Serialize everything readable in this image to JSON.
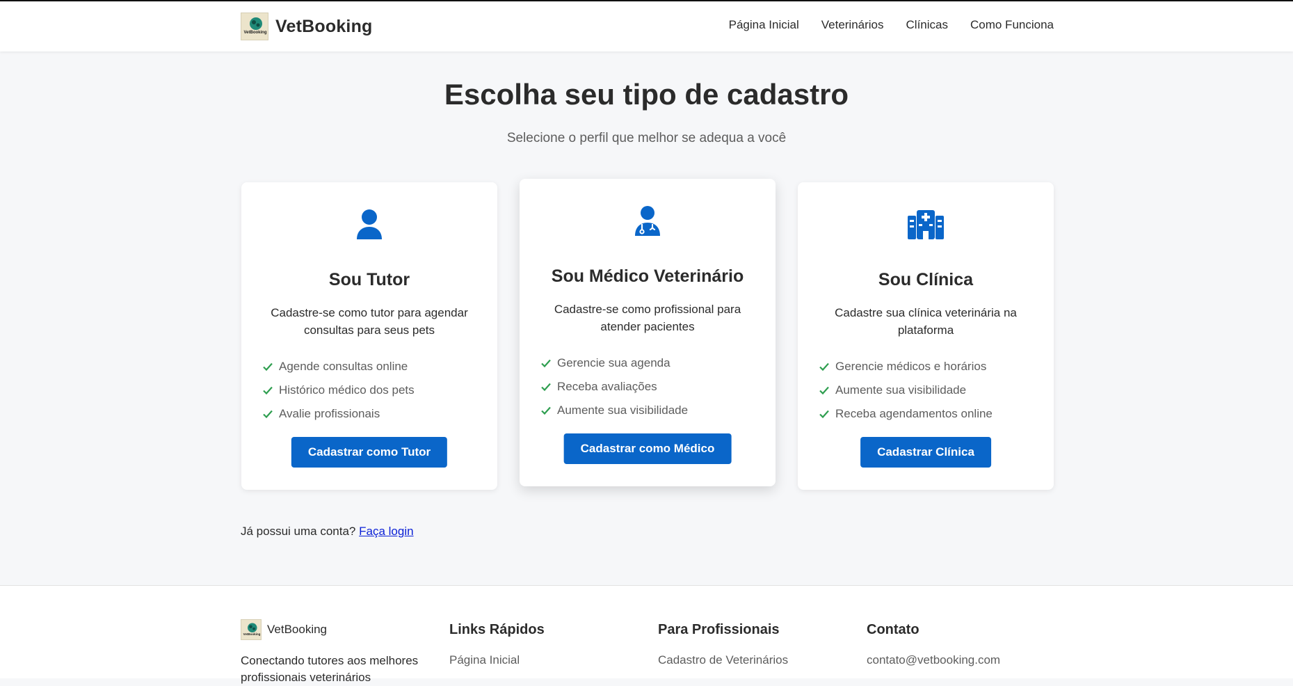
{
  "header": {
    "brand_name": "VetBooking",
    "nav": [
      "Página Inicial",
      "Veterinários",
      "Clínicas",
      "Como Funciona"
    ]
  },
  "hero": {
    "title": "Escolha seu tipo de cadastro",
    "subtitle": "Selecione o perfil que melhor se adequa a você"
  },
  "cards": [
    {
      "icon": "user-icon",
      "title": "Sou Tutor",
      "description": "Cadastre-se como tutor para agendar consultas para seus pets",
      "features": [
        "Agende consultas online",
        "Histórico médico dos pets",
        "Avalie profissionais"
      ],
      "button": "Cadastrar como Tutor"
    },
    {
      "icon": "user-doctor-icon",
      "title": "Sou Médico Veterinário",
      "description": "Cadastre-se como profissional para atender pacientes",
      "features": [
        "Gerencie sua agenda",
        "Receba avaliações",
        "Aumente sua visibilidade"
      ],
      "button": "Cadastrar como Médico"
    },
    {
      "icon": "hospital-icon",
      "title": "Sou Clínica",
      "description": "Cadastre sua clínica veterinária na plataforma",
      "features": [
        "Gerencie médicos e horários",
        "Aumente sua visibilidade",
        "Receba agendamentos online"
      ],
      "button": "Cadastrar Clínica"
    }
  ],
  "login": {
    "prompt": "Já possui uma conta?",
    "link": "Faça login"
  },
  "footer": {
    "brand_name": "VetBooking",
    "tagline": "Conectando tutores aos melhores profissionais veterinários",
    "quick_links": {
      "heading": "Links Rápidos",
      "items": [
        "Página Inicial"
      ]
    },
    "professionals": {
      "heading": "Para Profissionais",
      "items": [
        "Cadastro de Veterinários"
      ]
    },
    "contact": {
      "heading": "Contato",
      "items": [
        "contato@vetbooking.com"
      ]
    }
  },
  "colors": {
    "accent": "#0a66c9",
    "check": "#2e9e4f",
    "background": "#f6f7f9"
  }
}
